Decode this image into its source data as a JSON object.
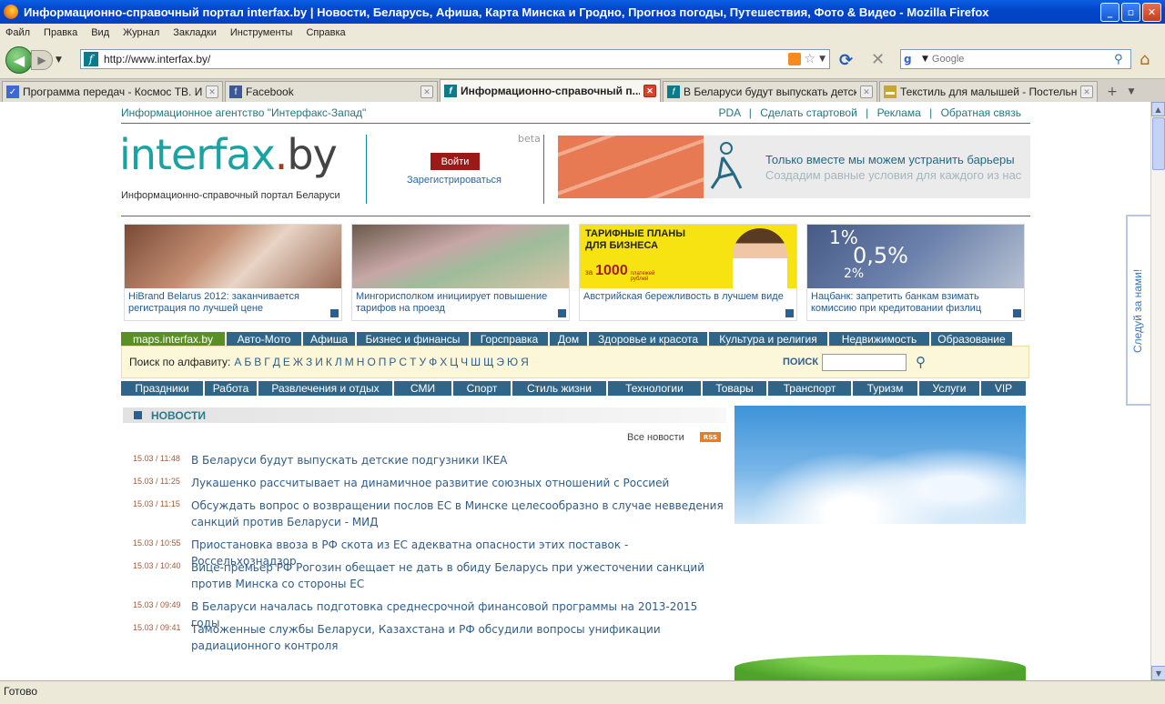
{
  "window": {
    "title": "Информационно-справочный портал interfax.by | Новости, Беларусь, Афиша, Карта Минска и Гродно, Прогноз погоды, Путешествия, Фото & Видео - Mozilla Firefox"
  },
  "menu": [
    "Файл",
    "Правка",
    "Вид",
    "Журнал",
    "Закладки",
    "Инструменты",
    "Справка"
  ],
  "nav": {
    "url": "http://www.interfax.by/",
    "search_placeholder": "Google"
  },
  "tabs": [
    {
      "label": "Программа передач - Космос ТВ. Ин...",
      "active": false
    },
    {
      "label": "Facebook",
      "active": false
    },
    {
      "label": "Информационно-справочный п...",
      "active": true
    },
    {
      "label": "В Беларуси будут выпускать детск...",
      "active": false
    },
    {
      "label": "Текстиль для малышей - Постельно...",
      "active": false
    }
  ],
  "page": {
    "agency": "Информационное агентство \"Интерфакс-Запад\"",
    "top_links": [
      "PDA",
      "Сделать стартовой",
      "Реклама",
      "Обратная связь"
    ],
    "logo_inter": "interfax",
    "logo_dot": ".",
    "logo_by": "by",
    "tagline": "Информационно-справочный портал Беларуси",
    "beta": "beta",
    "login": "Войти",
    "register": "Зарегистрироваться",
    "banner_line1": "Только вместе мы можем устранить барьеры",
    "banner_line2": "Создадим равные условия для каждого из нас",
    "promos": [
      "HiBrand Belarus 2012: заканчивается регистрация по лучшей цене",
      "Мингорисполком инициирует повышение тарифов на проезд",
      "Австрийская бережливость в лучшем виде",
      "Нацбанк: запретить банкам взимать комиссию при кредитовании физлиц"
    ],
    "promo3_title1": "ТАРИФНЫЕ ПЛАНЫ",
    "promo3_title2": "ДЛЯ БИЗНЕСА",
    "promo3_za": "за",
    "promo3_num": "1000",
    "promo3_unit": "платежей рублей",
    "promo4_p1": "1%",
    "promo4_p2": "0,5%",
    "promo4_p3": "2%",
    "cat_row1": [
      "maps.interfax.by",
      "Авто-Мото",
      "Афиша",
      "Бизнес и финансы",
      "Горсправка",
      "Дом",
      "Здоровье и красота",
      "Культура и религия",
      "Недвижимость",
      "Образование"
    ],
    "cat_row2": [
      "Праздники",
      "Работа",
      "Развлечения и отдых",
      "СМИ",
      "Спорт",
      "Стиль жизни",
      "Технологии",
      "Товары",
      "Транспорт",
      "Туризм",
      "Услуги",
      "VIP"
    ],
    "alpha_label": "Поиск по алфавиту:",
    "alpha_letters": [
      "А",
      "Б",
      "В",
      "Г",
      "Д",
      "Е",
      "Ж",
      "З",
      "И",
      "К",
      "Л",
      "М",
      "Н",
      "О",
      "П",
      "Р",
      "С",
      "Т",
      "У",
      "Ф",
      "Х",
      "Ц",
      "Ч",
      "Ш",
      "Щ",
      "Э",
      "Ю",
      "Я"
    ],
    "search_label": "ПОИСК",
    "news_title": "НОВОСТИ",
    "all_news": "Все новости",
    "rss": "RSS",
    "follow": "Следуй за нами!",
    "news": [
      {
        "time": "15.03 / 11:48",
        "text": "В Беларуси будут выпускать детские подгузники IKEA"
      },
      {
        "time": "15.03 / 11:25",
        "text": "Лукашенко рассчитывает на динамичное развитие союзных отношений с Россией"
      },
      {
        "time": "15.03 / 11:15",
        "text": "Обсуждать вопрос о возвращении послов ЕС в Минске целесообразно в случае невведения санкций против Беларуси - МИД"
      },
      {
        "time": "15.03 / 10:55",
        "text": "Приостановка ввоза в РФ скота из ЕС адекватна опасности этих поставок - Россельхознадзор"
      },
      {
        "time": "15.03 / 10:40",
        "text": "Вице-премьер РФ Рогозин обещает не дать в обиду Беларусь при ужесточении санкций против Минска со стороны ЕС"
      },
      {
        "time": "15.03 / 09:49",
        "text": "В Беларуси началась подготовка среднесрочной финансовой программы на 2013-2015 годы"
      },
      {
        "time": "15.03 / 09:41",
        "text": "Таможенные службы Беларуси, Казахстана и РФ обсудили вопросы унификации радиационного контроля"
      }
    ]
  },
  "status": "Готово"
}
